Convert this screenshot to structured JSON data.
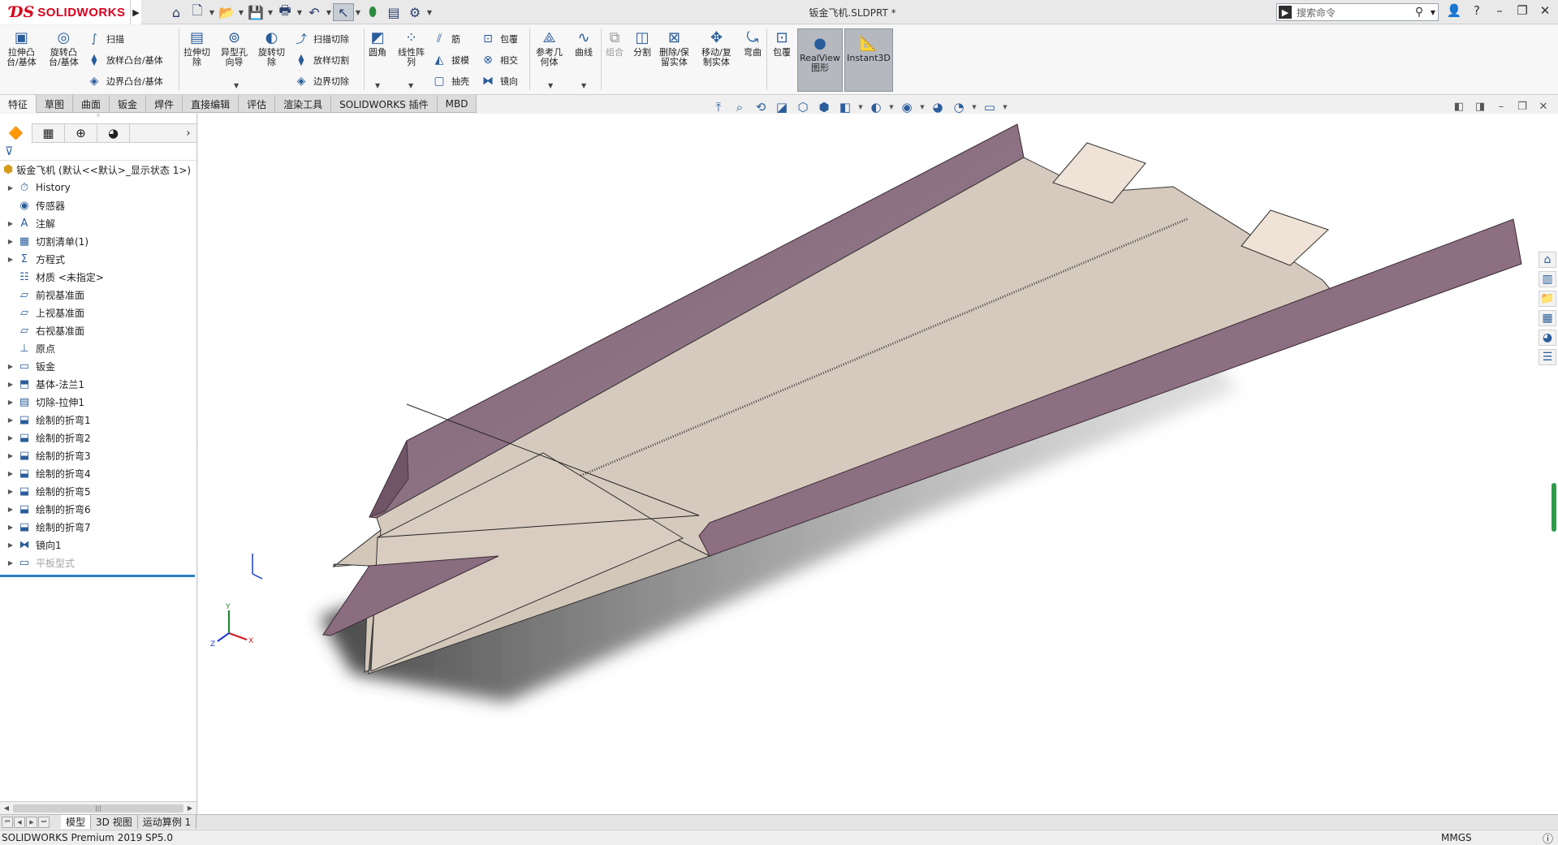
{
  "app": {
    "logo_text": "SOLIDWORKS",
    "logo_mark": "3DS",
    "document_title": "钣金飞机.SLDPRT *",
    "search_placeholder": "搜索命令"
  },
  "ribbon": {
    "groups": [
      {
        "id": "extrude_boss",
        "label": "拉伸凸\n台/基体"
      },
      {
        "id": "revolve_boss",
        "label": "旋转凸\n台/基体"
      },
      {
        "id": "sweep",
        "label": "扫描"
      },
      {
        "id": "loft_boss",
        "label": "放样凸台/基体"
      },
      {
        "id": "boundary_boss",
        "label": "边界凸台/基体"
      },
      {
        "id": "extrude_cut",
        "label": "拉伸切\n除"
      },
      {
        "id": "hole_wizard",
        "label": "异型孔\n向导"
      },
      {
        "id": "revolve_cut",
        "label": "旋转切\n除"
      },
      {
        "id": "sweep_cut",
        "label": "扫描切除"
      },
      {
        "id": "loft_cut",
        "label": "放样切割"
      },
      {
        "id": "boundary_cut",
        "label": "边界切除"
      },
      {
        "id": "fillet",
        "label": "圆角"
      },
      {
        "id": "linear_pattern",
        "label": "线性阵\n列"
      },
      {
        "id": "rib",
        "label": "筋"
      },
      {
        "id": "draft",
        "label": "拔模"
      },
      {
        "id": "shell",
        "label": "抽壳"
      },
      {
        "id": "wrap",
        "label": "包覆"
      },
      {
        "id": "intersect",
        "label": "相交"
      },
      {
        "id": "mirror",
        "label": "镜向"
      },
      {
        "id": "ref_geometry",
        "label": "参考几\n何体"
      },
      {
        "id": "curves",
        "label": "曲线"
      },
      {
        "id": "combine",
        "label": "组合"
      },
      {
        "id": "split",
        "label": "分割"
      },
      {
        "id": "delete_keep",
        "label": "删除/保\n留实体"
      },
      {
        "id": "move_copy",
        "label": "移动/复\n制实体"
      },
      {
        "id": "flex",
        "label": "弯曲"
      },
      {
        "id": "wrap2",
        "label": "包覆"
      },
      {
        "id": "realview",
        "label": "RealView\n图形"
      },
      {
        "id": "instant3d",
        "label": "Instant3D"
      }
    ]
  },
  "command_tabs": [
    "特征",
    "草图",
    "曲面",
    "钣金",
    "焊件",
    "直接编辑",
    "评估",
    "渲染工具",
    "SOLIDWORKS 插件",
    "MBD"
  ],
  "feature_tree": {
    "root": "钣金飞机  (默认<<默认>_显示状态 1>)",
    "items": [
      {
        "label": "History",
        "icon": "history-icon",
        "expandable": true
      },
      {
        "label": "传感器",
        "icon": "sensor-icon",
        "expandable": false
      },
      {
        "label": "注解",
        "icon": "annotation-icon",
        "expandable": true
      },
      {
        "label": "切割清单(1)",
        "icon": "cutlist-icon",
        "expandable": true
      },
      {
        "label": "方程式",
        "icon": "equation-icon",
        "expandable": true
      },
      {
        "label": "材质 <未指定>",
        "icon": "material-icon",
        "expandable": false
      },
      {
        "label": "前视基准面",
        "icon": "plane-icon",
        "expandable": false
      },
      {
        "label": "上视基准面",
        "icon": "plane-icon",
        "expandable": false
      },
      {
        "label": "右视基准面",
        "icon": "plane-icon",
        "expandable": false
      },
      {
        "label": "原点",
        "icon": "origin-icon",
        "expandable": false
      },
      {
        "label": "钣金",
        "icon": "sheetmetal-icon",
        "expandable": true
      },
      {
        "label": "基体-法兰1",
        "icon": "base-flange-icon",
        "expandable": true
      },
      {
        "label": "切除-拉伸1",
        "icon": "cut-extrude-icon",
        "expandable": true
      },
      {
        "label": "绘制的折弯1",
        "icon": "sketched-bend-icon",
        "expandable": true
      },
      {
        "label": "绘制的折弯2",
        "icon": "sketched-bend-icon",
        "expandable": true
      },
      {
        "label": "绘制的折弯3",
        "icon": "sketched-bend-icon",
        "expandable": true
      },
      {
        "label": "绘制的折弯4",
        "icon": "sketched-bend-icon",
        "expandable": true
      },
      {
        "label": "绘制的折弯5",
        "icon": "sketched-bend-icon",
        "expandable": true
      },
      {
        "label": "绘制的折弯6",
        "icon": "sketched-bend-icon",
        "expandable": true
      },
      {
        "label": "绘制的折弯7",
        "icon": "sketched-bend-icon",
        "expandable": true
      },
      {
        "label": "镜向1",
        "icon": "mirror-icon",
        "expandable": true
      },
      {
        "label": "平板型式",
        "icon": "flat-pattern-icon",
        "expandable": true,
        "dim": true
      }
    ]
  },
  "bottom_tabs": [
    "模型",
    "3D 视图",
    "运动算例 1"
  ],
  "status": {
    "product": "SOLIDWORKS Premium 2019 SP5.0",
    "units": "MMGS"
  },
  "colors": {
    "accent": "#2d7fc1",
    "brand_red": "#d6001c",
    "plane_face": "#d8ccc0",
    "flange_face": "#8a6a7e",
    "shadow": "#555555"
  }
}
